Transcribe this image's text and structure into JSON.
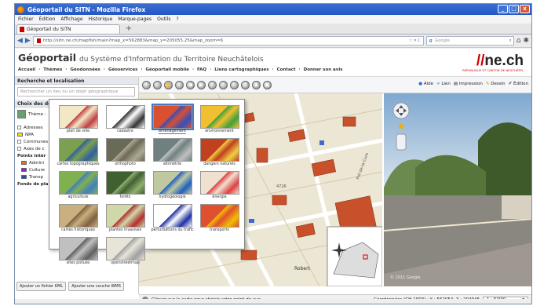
{
  "window": {
    "title": "Géoportail du SITN - Mozilla Firefox",
    "min": "_",
    "max": "□",
    "close": "x"
  },
  "menu": [
    "Fichier",
    "Édition",
    "Affichage",
    "Historique",
    "Marque-pages",
    "Outils",
    "?"
  ],
  "tab": {
    "label": "Géoportail du SITN",
    "new": "+"
  },
  "nav": {
    "url": "http://sitn.ne.ch/mapfish/main?map_x=562883&map_y=205055.25&map_zoom=6",
    "search_placeholder": "Google"
  },
  "header": {
    "title_bold": "Géoportail",
    "title_rest": "du Système d'Information du Territoire Neuchâtelois",
    "logo": "ne.ch",
    "logo_sub": "RÉPUBLIQUE ET CANTON DE NEUCHÂTEL"
  },
  "topnav": [
    "Accueil",
    "Thèmes",
    "Géodonnées",
    "Géoservices",
    "Géoportail mobile",
    "FAQ",
    "Liens cartographiques",
    "Contact",
    "Donner son avis"
  ],
  "left": {
    "search_title": "Recherche et localisation",
    "search_placeholder": "Rechercher un lieu ou un objet géographique",
    "data_title": "Choix des données",
    "theme_label": "Thème :",
    "layers": [
      "Adresses",
      "NPA",
      "Communes",
      "Axes de c",
      "Points intér",
      "Admini",
      "Culture",
      "Transp",
      "Fonds de pla"
    ],
    "btn_kml": "Ajouter un fichier KML",
    "btn_wms": "Ajouter une couche WMS"
  },
  "toolbar": {
    "actions": [
      "Aide",
      "Lien",
      "Impression",
      "Dessin",
      "Édition"
    ]
  },
  "themes": [
    "plan de ville",
    "cadastre",
    "aménagement",
    "environnement",
    "cartes topographiques",
    "orthophoto",
    "altimétrie",
    "dangers naturels",
    "agriculture",
    "forêts",
    "hydrogéologie",
    "énergie",
    "cartes historiques",
    "plantes invasives",
    "perturbations du trafic",
    "transports",
    "sites pollués",
    "openstreetmap"
  ],
  "status": {
    "hint": "Cliquer sur la carte pour choisir votre point de vue.",
    "coords": "Coordonnées (CH-1903) : Y : 562054, X : 204946",
    "scale": "1 : 6'000"
  },
  "map": {
    "labels": [
      "4726",
      "Pré-de-la-Cure",
      "Robert"
    ],
    "streetview_copyright": "© 2011 Google"
  }
}
